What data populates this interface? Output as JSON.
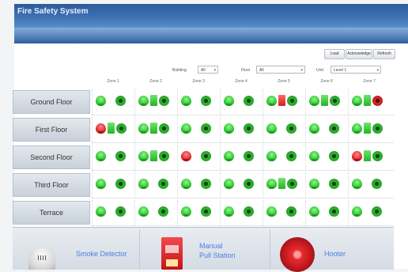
{
  "window": {
    "title": "Fire Safety System"
  },
  "toolbar": {
    "buttons": [
      "Load",
      "Acknowledge",
      "Refresh"
    ]
  },
  "filters": {
    "building": {
      "label": "Building",
      "value": "All"
    },
    "floor": {
      "label": "Floor",
      "value": "All"
    },
    "unit": {
      "label": "Unit",
      "value": "Level 1"
    }
  },
  "zones": [
    "Zone 1",
    "Zone 2",
    "Zone 3",
    "Zone 4",
    "Zone 5",
    "Zone 6",
    "Zone 7"
  ],
  "floors": [
    {
      "name": "Ground Floor",
      "zones": [
        [
          "smoke-ok",
          "hooter-ok"
        ],
        [
          "smoke-ok",
          "pull-ok",
          "hooter-ok"
        ],
        [
          "smoke-ok",
          "hooter-ok"
        ],
        [
          "smoke-ok",
          "hooter-ok"
        ],
        [
          "smoke-ok",
          "pull-alarm",
          "hooter-ok"
        ],
        [
          "smoke-ok",
          "pull-ok",
          "hooter-ok"
        ],
        [
          "smoke-ok",
          "pull-ok",
          "hooter-alarm"
        ]
      ]
    },
    {
      "name": "First Floor",
      "zones": [
        [
          "smoke-alarm",
          "pull-ok",
          "hooter-ok"
        ],
        [
          "smoke-ok",
          "pull-ok",
          "hooter-ok"
        ],
        [
          "smoke-ok",
          "hooter-ok"
        ],
        [
          "smoke-ok",
          "hooter-ok"
        ],
        [
          "smoke-ok",
          "hooter-ok"
        ],
        [
          "smoke-ok",
          "hooter-ok"
        ],
        [
          "smoke-ok",
          "pull-ok",
          "hooter-ok"
        ]
      ]
    },
    {
      "name": "Second Floor",
      "zones": [
        [
          "smoke-ok",
          "hooter-ok"
        ],
        [
          "smoke-ok",
          "pull-ok",
          "hooter-ok"
        ],
        [
          "smoke-alarm",
          "hooter-ok"
        ],
        [
          "smoke-ok",
          "hooter-ok"
        ],
        [
          "smoke-ok",
          "hooter-ok"
        ],
        [
          "smoke-ok",
          "hooter-ok"
        ],
        [
          "smoke-alarm",
          "pull-ok",
          "hooter-ok"
        ]
      ]
    },
    {
      "name": "Third Floor",
      "zones": [
        [
          "smoke-ok",
          "hooter-ok"
        ],
        [
          "smoke-ok",
          "hooter-ok"
        ],
        [
          "smoke-ok",
          "hooter-ok"
        ],
        [
          "smoke-ok",
          "hooter-ok"
        ],
        [
          "smoke-ok",
          "pull-ok",
          "hooter-ok"
        ],
        [
          "smoke-ok",
          "hooter-ok"
        ],
        [
          "smoke-ok",
          "hooter-ok"
        ]
      ]
    },
    {
      "name": "Terrace",
      "zones": [
        [
          "smoke-ok",
          "hooter-ok"
        ],
        [
          "smoke-ok",
          "hooter-ok"
        ],
        [
          "smoke-ok",
          "hooter-ok"
        ],
        [
          "smoke-ok",
          "hooter-ok"
        ],
        [
          "smoke-ok",
          "hooter-ok"
        ],
        [
          "smoke-ok",
          "hooter-ok"
        ],
        [
          "smoke-ok",
          "hooter-ok"
        ]
      ]
    }
  ],
  "legend": {
    "smoke": "Smoke Detector",
    "pull_line1": "Manual",
    "pull_line2": "Pull Station",
    "hooter": "Hooter"
  },
  "colors": {
    "normal": "#2fc42f",
    "alarm": "#e0262e",
    "title_bar": "#3f73b6",
    "legend_text": "#4a7ee0"
  }
}
